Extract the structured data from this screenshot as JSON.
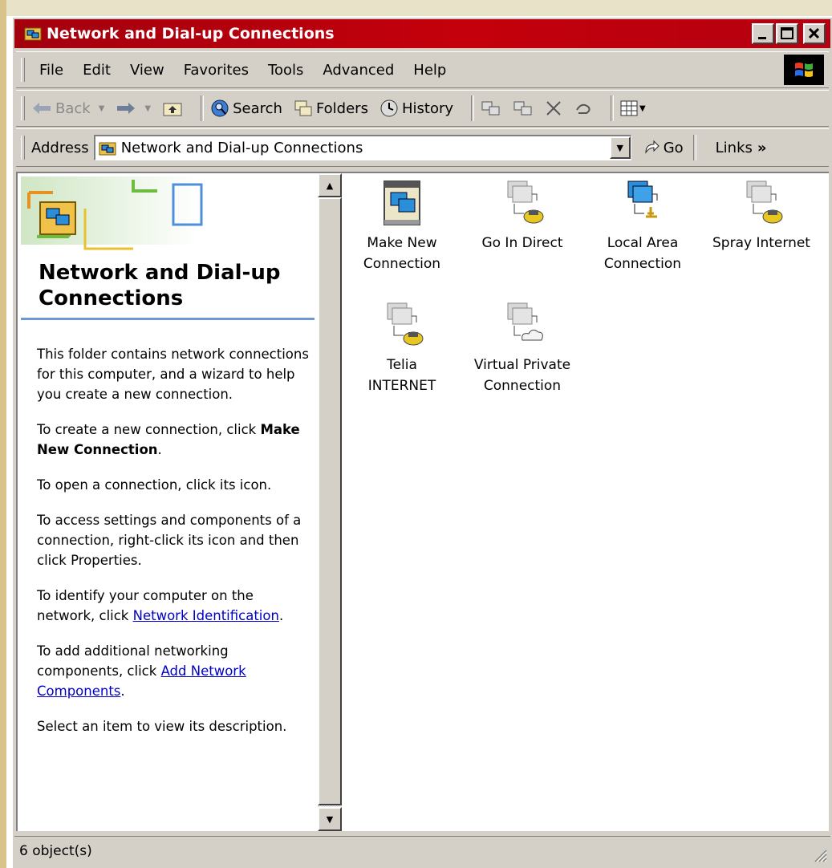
{
  "window": {
    "title": "Network and Dial-up Connections",
    "title_color": "#b0000c"
  },
  "menubar": {
    "items": [
      "File",
      "Edit",
      "View",
      "Favorites",
      "Tools",
      "Advanced",
      "Help"
    ]
  },
  "toolbar": {
    "back": "Back",
    "search": "Search",
    "folders": "Folders",
    "history": "History"
  },
  "address": {
    "label": "Address",
    "value": "Network and Dial-up Connections",
    "go": "Go",
    "links": "Links",
    "links_chevron": "»"
  },
  "leftpane": {
    "title": "Network and Dial-up Connections",
    "p1": "This folder contains network connections for this computer, and a wizard to help you create a new connection.",
    "p2_prefix": "To create a new connection, click",
    "p2_bold": "Make New Connection",
    "p2_suffix": ".",
    "p3": "To open a connection, click its icon.",
    "p4": "To access settings and components of a connection, right-click its icon and then click Properties.",
    "p5_prefix": "To identify your computer on the network, click",
    "p5_link": "Network Identification",
    "p5_suffix": ".",
    "p6_prefix": "To add additional networking components, click",
    "p6_link": "Add Network Components",
    "p6_suffix": ".",
    "p7": "Select an item to view its description.",
    "link_color": "#0000cc",
    "rule_color": "#6f97d6"
  },
  "items": [
    {
      "line1": "Make New",
      "line2": "Connection",
      "icon": "make-new-connection-icon"
    },
    {
      "line1": "Go In Direct",
      "line2": "",
      "icon": "dialup-connection-icon"
    },
    {
      "line1": "Local Area",
      "line2": "Connection",
      "icon": "lan-connection-icon"
    },
    {
      "line1": "Spray Internet",
      "line2": "",
      "icon": "dialup-connection-icon"
    },
    {
      "line1": "Telia",
      "line2": "INTERNET",
      "icon": "dialup-connection-icon"
    },
    {
      "line1": "Virtual Private",
      "line2": "Connection",
      "icon": "vpn-connection-icon"
    }
  ],
  "status": {
    "text": "6 object(s)"
  }
}
